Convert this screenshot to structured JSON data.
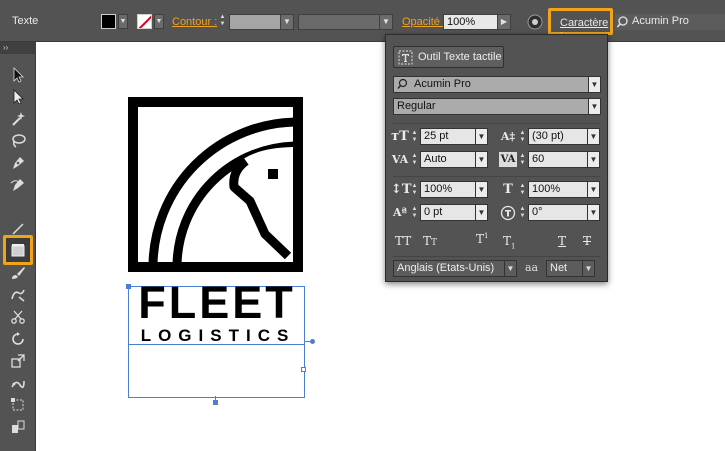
{
  "control_bar": {
    "tool_name": "Texte",
    "stroke_label": "Contour :",
    "opacity_label": "Opacité :",
    "opacity_value": "100%",
    "character_label": "Caractère :",
    "font_name": "Acumin Pro"
  },
  "logo": {
    "line1": "FLEET",
    "line2": "LOGISTICS"
  },
  "character_panel": {
    "touch_type_button": "Outil Texte tactile",
    "font_family": "Acumin Pro",
    "font_style": "Regular",
    "font_size": "25 pt",
    "leading": "(30 pt)",
    "kerning": "Auto",
    "tracking": "60",
    "vertical_scale": "100%",
    "horizontal_scale": "100%",
    "baseline_shift": "0 pt",
    "rotation": "0°",
    "language": "Anglais (Etats-Unis)",
    "antialias": "Net",
    "antialias_icon_text": "aa"
  },
  "colors": {
    "accent_highlight": "#f1a31a",
    "selection_blue": "#4a7fd4",
    "ui_dark": "#535353"
  }
}
